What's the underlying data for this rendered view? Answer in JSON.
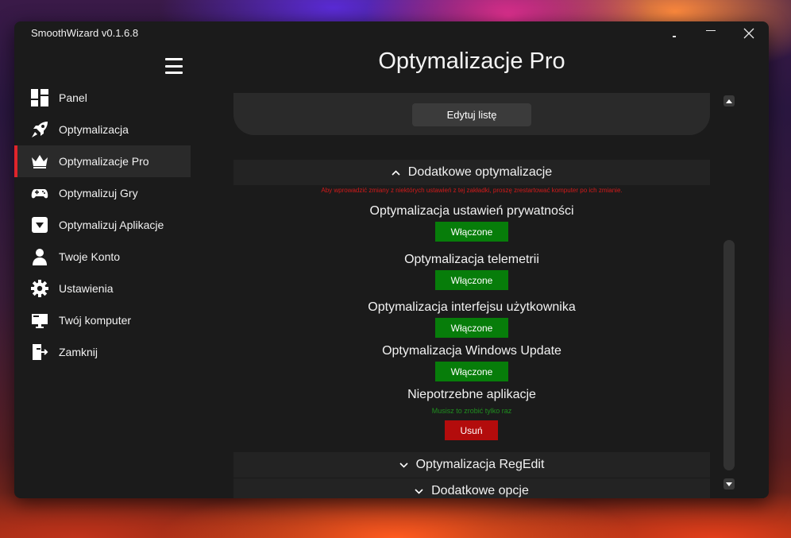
{
  "app": {
    "title": "SmoothWizard v0.1.6.8"
  },
  "window_controls": {
    "minimize": "minimize-icon",
    "maximize": "maximize-icon",
    "close": "close-icon"
  },
  "header": {
    "title": "Optymalizacje Pro",
    "menu_icon": "hamburger-icon"
  },
  "sidebar": {
    "items": [
      {
        "label": "Panel",
        "icon": "dashboard-icon"
      },
      {
        "label": "Optymalizacja",
        "icon": "rocket-icon"
      },
      {
        "label": "Optymalizacje Pro",
        "icon": "crown-icon",
        "active": true
      },
      {
        "label": "Optymalizuj Gry",
        "icon": "gamepad-icon"
      },
      {
        "label": "Optymalizuj Aplikacje",
        "icon": "app-store-icon"
      },
      {
        "label": "Twoje Konto",
        "icon": "user-icon"
      },
      {
        "label": "Ustawienia",
        "icon": "gear-icon"
      },
      {
        "label": "Twój komputer",
        "icon": "computer-icon"
      },
      {
        "label": "Zamknij",
        "icon": "exit-icon"
      }
    ]
  },
  "main": {
    "edit_list_button": "Edytuj listę",
    "sections": {
      "additional": {
        "title": "Dodatkowe optymalizacje",
        "warning": "Aby wprowadzić zmiany z niektórych ustawień z tej zakładki, proszę zrestartować komputer po ich zmianie.",
        "options": [
          {
            "label": "Optymalizacja ustawień prywatności",
            "button": "Włączone"
          },
          {
            "label": "Optymalizacja telemetrii",
            "button": "Włączone"
          },
          {
            "label": "Optymalizacja interfejsu użytkownika",
            "button": "Włączone"
          },
          {
            "label": "Optymalizacja Windows Update",
            "button": "Włączone"
          }
        ],
        "unneeded_apps": {
          "label": "Niepotrzebne aplikacje",
          "note": "Musisz to zrobić tylko raz",
          "button": "Usuń"
        }
      },
      "regedit": {
        "title": "Optymalizacja RegEdit"
      },
      "extra_options": {
        "title": "Dodatkowe opcje"
      }
    }
  },
  "colors": {
    "accent_red": "#e0242b",
    "enabled_green": "#077d0a",
    "remove_red": "#b30c0c",
    "warning_red": "#d21a1a",
    "note_green": "#1f8f1f",
    "background": "#1b1b1b"
  }
}
